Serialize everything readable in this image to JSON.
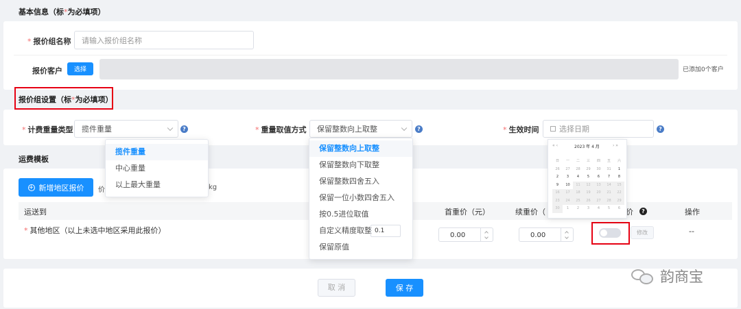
{
  "basic_info": {
    "title_prefix": "基本信息（标",
    "title_star": "*",
    "title_suffix": "为必填项）",
    "group_name_label": "报价组名称",
    "group_name_placeholder": "请输入报价组名称",
    "customer_label": "报价客户",
    "select_button": "选择",
    "added_count": "已添加0个客户"
  },
  "group_settings": {
    "title_prefix": "报价组设置（标",
    "title_star": "*",
    "title_suffix": "为必填项）",
    "weight_type_label": "计费重量类型",
    "weight_type_value": "揽件重量",
    "weight_type_options": [
      "揽件重量",
      "中心重量",
      "以上最大重量"
    ],
    "rounding_label": "重量取值方式",
    "rounding_value": "保留整数向上取整",
    "rounding_options": [
      "保留整数向上取整",
      "保留整数向下取整",
      "保留整数四舍五入",
      "保留一位小数四舍五入",
      "按0.5进位取值"
    ],
    "custom_precision_label": "自定义精度取整",
    "custom_precision_value": "0.1",
    "keep_original": "保留原值",
    "effective_label": "生效时间",
    "effective_placeholder": "选择日期"
  },
  "calendar": {
    "header": "2023 年  4 月",
    "weekdays": [
      "日",
      "一",
      "二",
      "三",
      "四",
      "五",
      "六"
    ],
    "days": [
      "26",
      "27",
      "28",
      "29",
      "30",
      "31",
      "1",
      "2",
      "3",
      "4",
      "5",
      "6",
      "7",
      "8",
      "9",
      "10",
      "11",
      "12",
      "13",
      "14",
      "15",
      "16",
      "17",
      "18",
      "19",
      "20",
      "21",
      "22",
      "23",
      "24",
      "25",
      "26",
      "27",
      "28",
      "29",
      "30",
      "1",
      "2",
      "3",
      "4",
      "5",
      "6"
    ]
  },
  "freight": {
    "title": "运费模板",
    "add_region_button": "新增地区报价",
    "partial_price": "价",
    "partial_kg": "kg",
    "columns": {
      "ship_to": "运送到",
      "first_weight": "首重价（元）",
      "additional_weight": "续重价（",
      "price": "价",
      "action": "操作"
    },
    "row": {
      "region": "其他地区（以上未选中地区采用此报价）",
      "first_price": "0.00",
      "additional_price": "0.00",
      "edit_button": "修改",
      "action_value": "--"
    }
  },
  "footer": {
    "cancel": "取 消",
    "save": "保 存"
  },
  "watermark": "韵商宝"
}
